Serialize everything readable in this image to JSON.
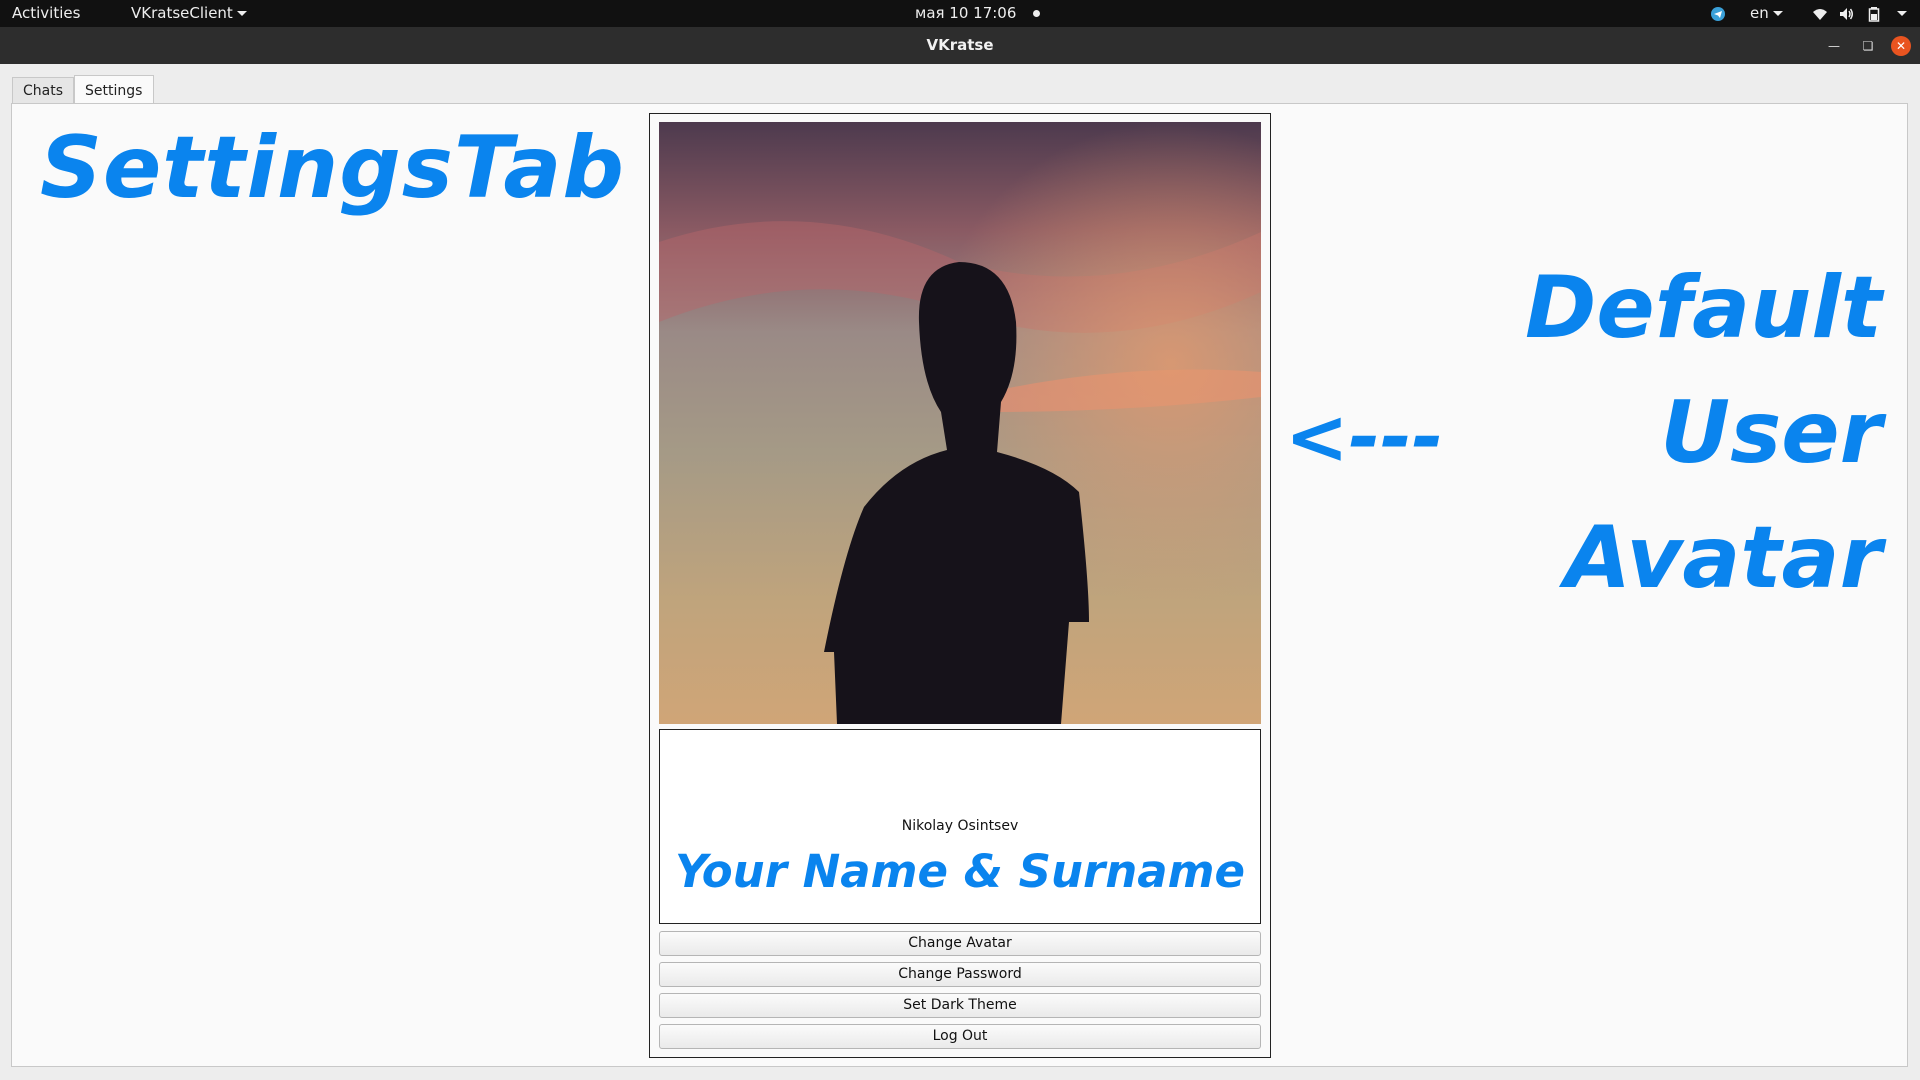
{
  "topbar": {
    "activities": "Activities",
    "app_menu": "VKratseClient",
    "clock": "мая 10  17:06",
    "language": "en"
  },
  "window": {
    "title": "VKratse"
  },
  "tabs": [
    {
      "label": "Chats",
      "active": false
    },
    {
      "label": "Settings",
      "active": true
    }
  ],
  "annotations": {
    "settings_tab": "SettingsTab",
    "arrow": "<---",
    "default_line1": "Default",
    "default_line2": "User",
    "default_line3": "Avatar",
    "name_hint": "Your Name & Surname",
    "color": "#0a84ee"
  },
  "profile": {
    "name": "Nikolay Osintsev"
  },
  "buttons": {
    "change_avatar": "Change Avatar",
    "change_password": "Change Password",
    "set_dark_theme": "Set Dark Theme",
    "log_out": "Log Out"
  },
  "icons": [
    "telegram-icon",
    "wifi-icon",
    "volume-icon",
    "battery-icon",
    "minimize-icon",
    "restore-icon",
    "close-icon"
  ]
}
